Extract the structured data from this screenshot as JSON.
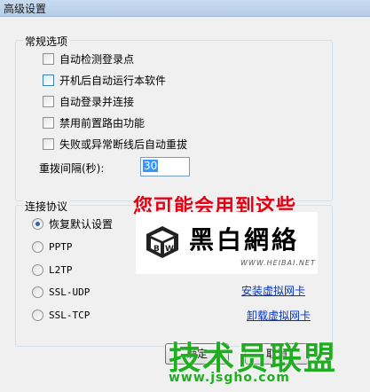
{
  "window": {
    "title": "高级设置"
  },
  "general": {
    "legend": "常规选项",
    "checkboxes": [
      {
        "label": "自动检测登录点",
        "checked": false
      },
      {
        "label": "开机后自动运行本软件",
        "checked": false
      },
      {
        "label": "自动登录并连接",
        "checked": false
      },
      {
        "label": "禁用前置路由功能",
        "checked": false
      },
      {
        "label": "失败或异常断线后自动重拔",
        "checked": false
      }
    ],
    "redial_label": "重拨间隔(秒):",
    "redial_value": "30"
  },
  "protocol": {
    "legend": "连接协议",
    "options": [
      {
        "label": "恢复默认设置",
        "selected": true
      },
      {
        "label": "PPTP",
        "selected": false
      },
      {
        "label": "L2TP",
        "selected": false
      },
      {
        "label": "SSL-UDP",
        "selected": false
      },
      {
        "label": "SSL-TCP",
        "selected": false
      }
    ],
    "install_link": "安装虚拟网卡",
    "uninstall_link": "卸载虚拟网卡"
  },
  "buttons": {
    "ok": "确定",
    "cancel": "取消"
  },
  "watermarks": {
    "red_text": "您可能会用到这些",
    "logo_text": "黑白網絡",
    "logo_url": "WWW.HEIBAI.NET",
    "green_text": "技术员联盟",
    "green_url": "www.jsgho.com"
  },
  "colors": {
    "link": "#0033cc",
    "red": "#e60012",
    "green": "#1fae1f",
    "radio_dot": "#2a64b5"
  }
}
